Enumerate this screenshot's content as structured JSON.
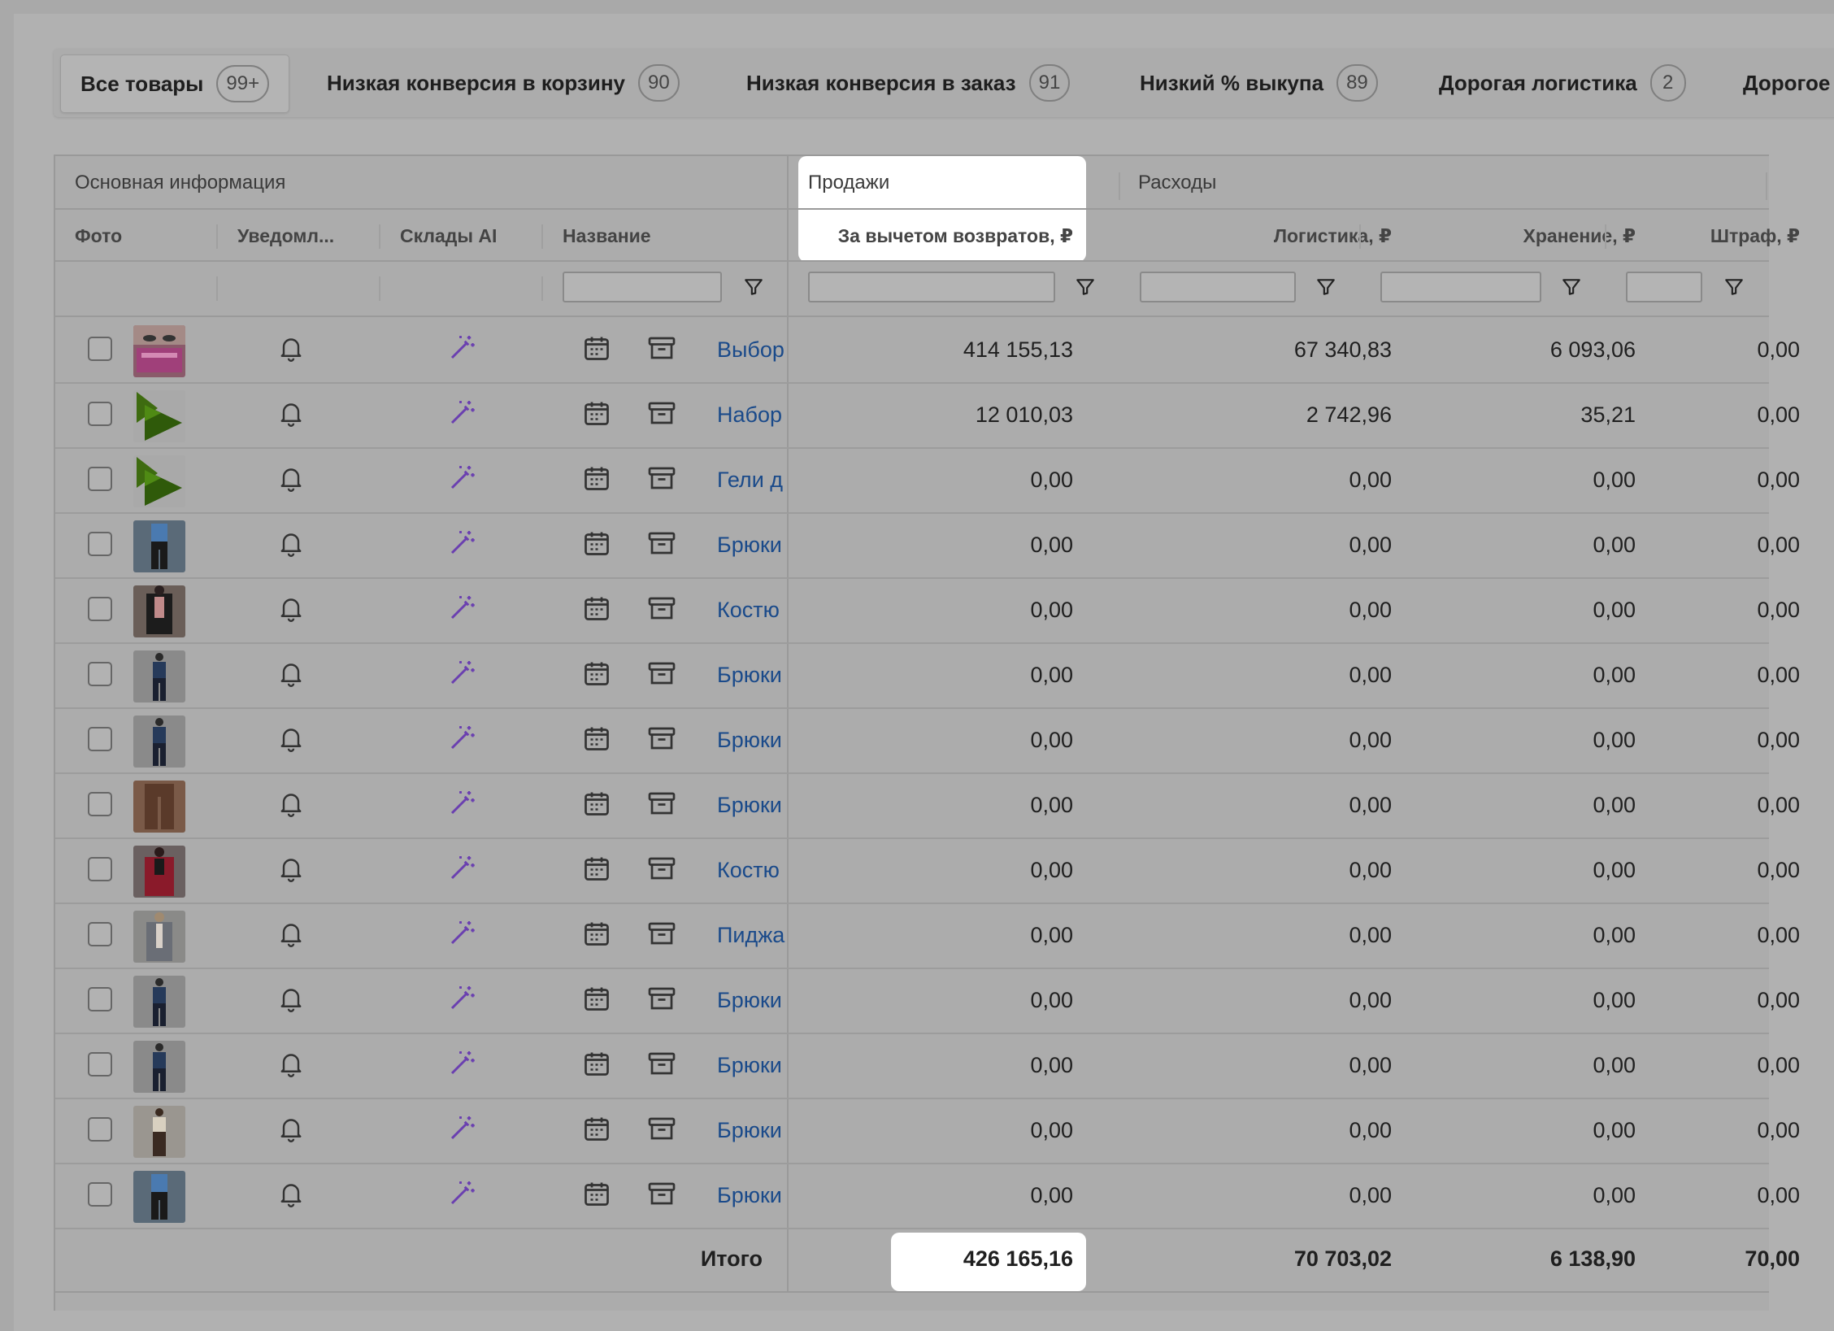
{
  "tabs": [
    {
      "label": "Все товары",
      "count": "99+"
    },
    {
      "label": "Низкая конверсия в корзину",
      "count": "90"
    },
    {
      "label": "Низкая конверсия в заказ",
      "count": "91"
    },
    {
      "label": "Низкий % выкупа",
      "count": "89"
    },
    {
      "label": "Дорогая логистика",
      "count": "2"
    },
    {
      "label": "Дорогое",
      "count": ""
    }
  ],
  "groups": {
    "main": "Основная информация",
    "sales": "Продажи",
    "expenses": "Расходы"
  },
  "columns": {
    "photo": "Фото",
    "notify": "Уведомл...",
    "warehouses": "Склады AI",
    "name": "Название",
    "net_sales": "За вычетом возвратов, ₽",
    "logistics": "Логистика, ₽",
    "storage": "Хранение, ₽",
    "fine": "Штраф, ₽"
  },
  "rows": [
    {
      "name": "Выбор",
      "thumb": "pink",
      "sales": "414 155,13",
      "logistics": "67 340,83",
      "storage": "6 093,06",
      "fine": "0,00"
    },
    {
      "name": "Набор",
      "thumb": "green",
      "sales": "12 010,03",
      "logistics": "2 742,96",
      "storage": "35,21",
      "fine": "0,00"
    },
    {
      "name": "Гели д",
      "thumb": "green",
      "sales": "0,00",
      "logistics": "0,00",
      "storage": "0,00",
      "fine": "0,00"
    },
    {
      "name": "Брюки",
      "thumb": "blue",
      "sales": "0,00",
      "logistics": "0,00",
      "storage": "0,00",
      "fine": "0,00"
    },
    {
      "name": "Костю",
      "thumb": "dark",
      "sales": "0,00",
      "logistics": "0,00",
      "storage": "0,00",
      "fine": "0,00"
    },
    {
      "name": "Брюки",
      "thumb": "navy",
      "sales": "0,00",
      "logistics": "0,00",
      "storage": "0,00",
      "fine": "0,00"
    },
    {
      "name": "Брюки",
      "thumb": "navy",
      "sales": "0,00",
      "logistics": "0,00",
      "storage": "0,00",
      "fine": "0,00"
    },
    {
      "name": "Брюки",
      "thumb": "brown",
      "sales": "0,00",
      "logistics": "0,00",
      "storage": "0,00",
      "fine": "0,00"
    },
    {
      "name": "Костю",
      "thumb": "red",
      "sales": "0,00",
      "logistics": "0,00",
      "storage": "0,00",
      "fine": "0,00"
    },
    {
      "name": "Пиджа",
      "thumb": "grey",
      "sales": "0,00",
      "logistics": "0,00",
      "storage": "0,00",
      "fine": "0,00"
    },
    {
      "name": "Брюки",
      "thumb": "navy",
      "sales": "0,00",
      "logistics": "0,00",
      "storage": "0,00",
      "fine": "0,00"
    },
    {
      "name": "Брюки",
      "thumb": "navy",
      "sales": "0,00",
      "logistics": "0,00",
      "storage": "0,00",
      "fine": "0,00"
    },
    {
      "name": "Брюки",
      "thumb": "beige",
      "sales": "0,00",
      "logistics": "0,00",
      "storage": "0,00",
      "fine": "0,00"
    },
    {
      "name": "Брюки",
      "thumb": "blue",
      "sales": "0,00",
      "logistics": "0,00",
      "storage": "0,00",
      "fine": "0,00"
    }
  ],
  "totals": {
    "label": "Итого",
    "sales": "426 165,16",
    "logistics": "70 703,02",
    "storage": "6 138,90",
    "fine": "70,00"
  },
  "icons": {
    "row_notify": "bell-icon",
    "row_ai": "magic-wand-icon",
    "row_calendar": "calendar-icon",
    "row_archive": "archive-icon",
    "filter": "filter-icon"
  },
  "colors": {
    "link": "#1a4a8a",
    "ai_icon": "#6a3fb0",
    "highlight": "#ffffff",
    "dim_overlay": "#a9a9a9"
  }
}
